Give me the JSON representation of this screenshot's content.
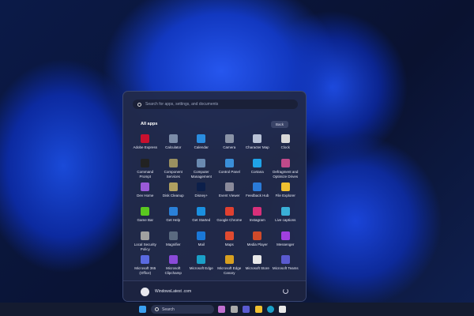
{
  "start_menu": {
    "search_placeholder": "Search for apps, settings, and documents",
    "section_title": "All apps",
    "back_label": "Back",
    "apps": [
      {
        "label": "Adobe Express",
        "color": "#c8102e"
      },
      {
        "label": "Calculator",
        "color": "#7b8ca8"
      },
      {
        "label": "Calendar",
        "color": "#2a8de0"
      },
      {
        "label": "Camera",
        "color": "#8a93a6"
      },
      {
        "label": "Character Map",
        "color": "#b8c2d6"
      },
      {
        "label": "Clock",
        "color": "#d8d8d8"
      },
      {
        "label": "Command Prompt",
        "color": "#222"
      },
      {
        "label": "Component Services",
        "color": "#9a9060"
      },
      {
        "label": "Computer Management",
        "color": "#6a8ab0"
      },
      {
        "label": "Control Panel",
        "color": "#3a8fd8"
      },
      {
        "label": "Cortana",
        "color": "#1fa3e8"
      },
      {
        "label": "Defragment and Optimize Drives",
        "color": "#c04a8a"
      },
      {
        "label": "Dev Home",
        "color": "#9a5ad8"
      },
      {
        "label": "Disk Cleanup",
        "color": "#b0a060"
      },
      {
        "label": "Disney+",
        "color": "#0c1f4a"
      },
      {
        "label": "Event Viewer",
        "color": "#8a8a9a"
      },
      {
        "label": "Feedback Hub",
        "color": "#2a7ad8"
      },
      {
        "label": "File Explorer",
        "color": "#f0c030"
      },
      {
        "label": "Game Bar",
        "color": "#5ac820"
      },
      {
        "label": "Get Help",
        "color": "#2a80d8"
      },
      {
        "label": "Get Started",
        "color": "#1a90e0"
      },
      {
        "label": "Google Chrome",
        "color": "#e04030"
      },
      {
        "label": "Instagram",
        "color": "#d8307a"
      },
      {
        "label": "Live captions",
        "color": "#3ab0d8"
      },
      {
        "label": "Local Security Policy",
        "color": "#a0a0a0"
      },
      {
        "label": "Magnifier",
        "color": "#5a6a80"
      },
      {
        "label": "Mail",
        "color": "#1a78d8"
      },
      {
        "label": "Maps",
        "color": "#e04a30"
      },
      {
        "label": "Media Player",
        "color": "#d04a2a"
      },
      {
        "label": "Messenger",
        "color": "#a040e0"
      },
      {
        "label": "Microsoft 365 (Office)",
        "color": "#5a6ae0"
      },
      {
        "label": "Microsoft Clipchamp",
        "color": "#8a4ad8"
      },
      {
        "label": "Microsoft Edge",
        "color": "#1aa0c8"
      },
      {
        "label": "Microsoft Edge Canary",
        "color": "#d8a020"
      },
      {
        "label": "Microsoft Store",
        "color": "#e8e8e8"
      },
      {
        "label": "Microsoft Teams",
        "color": "#5a5ad0"
      }
    ],
    "user_name": "WindowsLatest .com"
  },
  "taskbar": {
    "search_label": "Search"
  }
}
